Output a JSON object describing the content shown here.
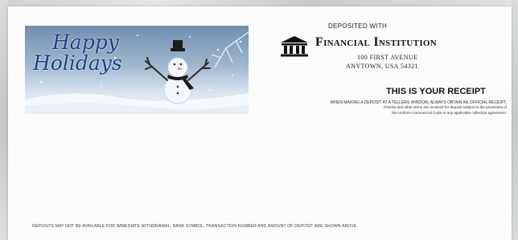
{
  "banner": {
    "greeting_line1": "Happy",
    "greeting_line2": "Holidays",
    "image_subject": "snowman-in-snow"
  },
  "header": {
    "deposited_with": "DEPOSITED WITH",
    "bank_name": "Financial Institution",
    "address_line1": "100 FIRST AVENUE",
    "address_line2": "ANYTOWN, USA 54321",
    "icon": "bank-building-icon"
  },
  "receipt": {
    "title": "THIS IS YOUR RECEIPT",
    "notice_line1": "WHEN MAKING A DEPOSIT AT A TELLERS WINDOW, ALWAYS OBTAIN AN OFFICIAL RECEIPT.",
    "notice_line2": "Checks and other items are received for deposit subject to the provisions of",
    "notice_line3": "the Uniform Commercial Code or any applicable collection agreement."
  },
  "footer": {
    "text": "DEPOSITS MAY NOT BE AVAILABLE FOR IMMEDIATE WITHDRAWAL. BANK SYMBOL, TRANSACTION NUMBER AND AMOUNT OF DEPOSIT ARE SHOWN ABOVE."
  },
  "colors": {
    "greeting": "#1f3f86",
    "paper": "#fbfbfb",
    "backdrop": "#d7d9d9"
  }
}
